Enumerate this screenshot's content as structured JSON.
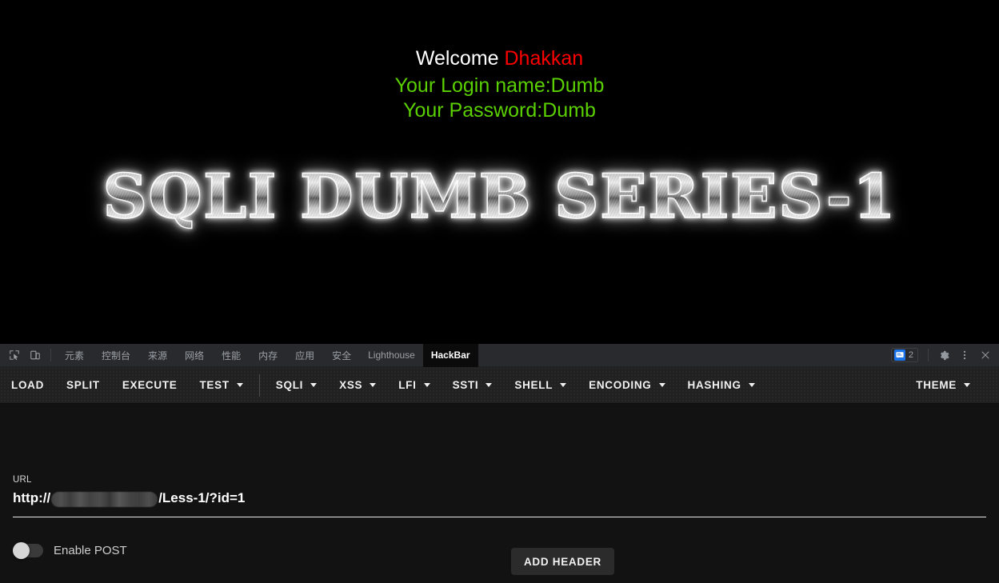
{
  "page": {
    "welcome_prefix": "Welcome ",
    "welcome_name": "Dhakkan",
    "login_line": "Your Login name:Dumb",
    "password_line": "Your Password:Dumb",
    "logo_text": "SQLI DUMB SERIES-1",
    "colors": {
      "background": "#000000",
      "welcome_text": "#ffffff",
      "welcome_name": "#fe0000",
      "credentials": "#5ad000"
    }
  },
  "devtools": {
    "icons": {
      "inspect": "inspect-element-icon",
      "device": "device-toolbar-icon"
    },
    "tabs": [
      {
        "label": "元素",
        "active": false,
        "cjk": true
      },
      {
        "label": "控制台",
        "active": false,
        "cjk": true
      },
      {
        "label": "来源",
        "active": false,
        "cjk": true
      },
      {
        "label": "网络",
        "active": false,
        "cjk": true
      },
      {
        "label": "性能",
        "active": false,
        "cjk": true
      },
      {
        "label": "内存",
        "active": false,
        "cjk": true
      },
      {
        "label": "应用",
        "active": false,
        "cjk": true
      },
      {
        "label": "安全",
        "active": false,
        "cjk": true
      },
      {
        "label": "Lighthouse",
        "active": false,
        "cjk": false
      },
      {
        "label": "HackBar",
        "active": true,
        "cjk": false
      }
    ],
    "issues_count": "2",
    "right_icons": {
      "issues": "message-badge-icon",
      "settings": "gear-icon",
      "more": "more-vertical-icon",
      "close": "close-icon"
    },
    "colors": {
      "tabbar_bg": "#292a2d",
      "panel_bg": "#121212",
      "active_tab_bg": "#0b0b0b",
      "badge_blue": "#1a73e8",
      "tab_text": "#9aa0a6"
    }
  },
  "hackbar": {
    "menu": [
      {
        "label": "LOAD",
        "caret": false
      },
      {
        "label": "SPLIT",
        "caret": false
      },
      {
        "label": "EXECUTE",
        "caret": false
      },
      {
        "label": "TEST",
        "caret": true
      },
      {
        "label": "SQLI",
        "caret": true
      },
      {
        "label": "XSS",
        "caret": true
      },
      {
        "label": "LFI",
        "caret": true
      },
      {
        "label": "SSTI",
        "caret": true
      },
      {
        "label": "SHELL",
        "caret": true
      },
      {
        "label": "ENCODING",
        "caret": true
      },
      {
        "label": "HASHING",
        "caret": true
      }
    ],
    "theme_label": "THEME",
    "url": {
      "label": "URL",
      "scheme": "http://",
      "host_redacted": true,
      "path": "/Less-1/?id=1"
    },
    "enable_post": {
      "label": "Enable POST",
      "enabled": false
    },
    "add_header_label": "ADD HEADER"
  }
}
